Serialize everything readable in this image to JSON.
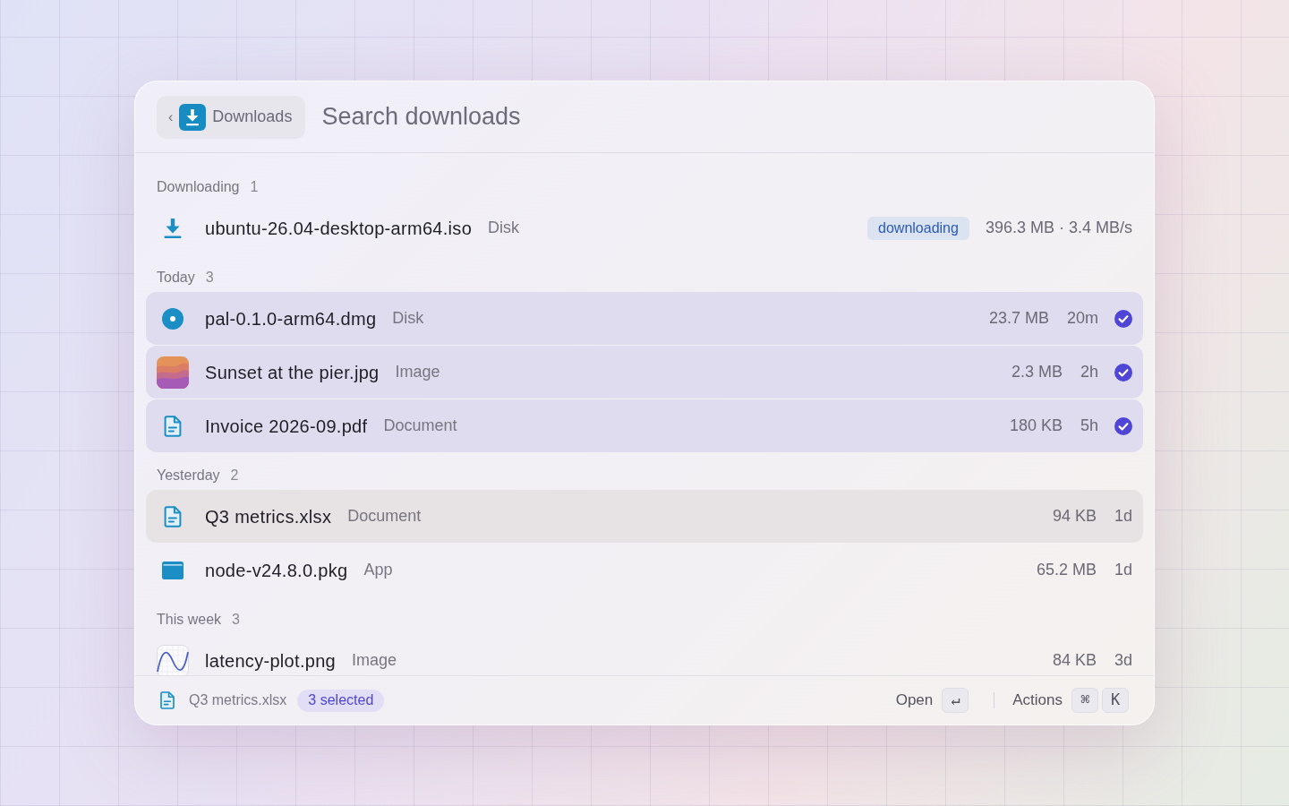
{
  "search": {
    "back_glyph": "‹",
    "scope": "Downloads",
    "placeholder": "Search downloads"
  },
  "sections": [
    {
      "title": "Downloading",
      "count": "1",
      "items": [
        {
          "kind": "download",
          "name": "ubuntu-26.04-desktop-arm64.iso",
          "type": "Disk",
          "badge": "downloading",
          "size": "396.3 MB · 3.4 MB/s",
          "selected": false,
          "highlighted": false
        }
      ]
    },
    {
      "title": "Today",
      "count": "3",
      "items": [
        {
          "kind": "disk",
          "name": "pal-0.1.0-arm64.dmg",
          "type": "Disk",
          "size": "23.7 MB",
          "age": "20m",
          "selected": true,
          "highlighted": false
        },
        {
          "kind": "photo",
          "name": "Sunset at the pier.jpg",
          "type": "Image",
          "size": "2.3 MB",
          "age": "2h",
          "selected": true,
          "highlighted": false
        },
        {
          "kind": "document",
          "name": "Invoice 2026-09.pdf",
          "type": "Document",
          "size": "180 KB",
          "age": "5h",
          "selected": true,
          "highlighted": false
        }
      ]
    },
    {
      "title": "Yesterday",
      "count": "2",
      "items": [
        {
          "kind": "document",
          "name": "Q3 metrics.xlsx",
          "type": "Document",
          "size": "94 KB",
          "age": "1d",
          "selected": false,
          "highlighted": true
        },
        {
          "kind": "app",
          "name": "node-v24.8.0.pkg",
          "type": "App",
          "size": "65.2 MB",
          "age": "1d",
          "selected": false,
          "highlighted": false
        }
      ]
    },
    {
      "title": "This week",
      "count": "3",
      "items": [
        {
          "kind": "plot",
          "name": "latency-plot.png",
          "type": "Image",
          "size": "84 KB",
          "age": "3d",
          "selected": false,
          "highlighted": false
        }
      ]
    }
  ],
  "footer": {
    "current": {
      "kind": "document",
      "name": "Q3 metrics.xlsx"
    },
    "selection": "3 selected",
    "actions": [
      {
        "label": "Open",
        "keys": [
          "↵"
        ]
      },
      {
        "label": "Actions",
        "keys": [
          "⌘",
          "K"
        ]
      }
    ]
  }
}
